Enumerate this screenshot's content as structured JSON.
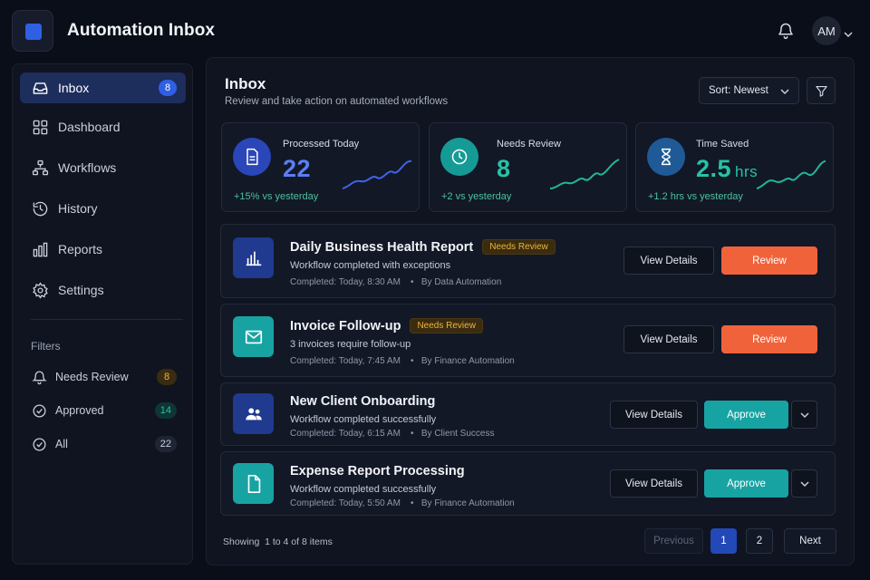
{
  "app": {
    "title": "Automation Inbox",
    "user_initials": "AM"
  },
  "sidebar": {
    "nav": [
      {
        "label": "Inbox",
        "badge": "8",
        "icon": "inbox-icon",
        "active": true
      },
      {
        "label": "Dashboard",
        "icon": "dashboard-icon"
      },
      {
        "label": "Workflows",
        "icon": "workflow-icon"
      },
      {
        "label": "History",
        "icon": "history-icon"
      },
      {
        "label": "Reports",
        "icon": "reports-icon"
      },
      {
        "label": "Settings",
        "icon": "gear-icon"
      }
    ],
    "filters_title": "Filters",
    "filters": [
      {
        "label": "Needs Review",
        "count": "8",
        "icon": "bell-icon",
        "color": "#f0b43c"
      },
      {
        "label": "Approved",
        "count": "14",
        "icon": "check-circle-icon",
        "color": "#27c2a5"
      },
      {
        "label": "All",
        "count": "22",
        "icon": "check-circle-icon",
        "color": "#c9cfdb"
      }
    ]
  },
  "main": {
    "title": "Inbox",
    "subtitle": "Review and take action on automated workflows",
    "sort_label": "Sort: Newest"
  },
  "stats": [
    {
      "label": "Processed Today",
      "value": "22",
      "unit": "",
      "delta": "+15% vs yesterday",
      "color": "#4c6ff0",
      "icon": "document-icon"
    },
    {
      "label": "Needs Review",
      "value": "8",
      "unit": "",
      "delta": "+2 vs yesterday",
      "color": "#27c2a5",
      "icon": "clock-icon"
    },
    {
      "label": "Time Saved",
      "value": "2.5",
      "unit": "hrs",
      "delta": "+1.2 hrs vs yesterday",
      "color": "#27c2a5",
      "icon": "hourglass-icon"
    }
  ],
  "workflows": [
    {
      "title": "Daily Business Health Report",
      "badge": "Needs Review",
      "desc": "Workflow completed with exceptions",
      "completed": "Completed: Today, 8:30 AM",
      "by": "By Data Automation",
      "details_label": "View Details",
      "action_label": "Review",
      "icon": "bar-chart-icon"
    },
    {
      "title": "Invoice Follow-up",
      "badge": "Needs Review",
      "desc": "3 invoices require follow-up",
      "completed": "Completed: Today, 7:45 AM",
      "by": "By Finance Automation",
      "details_label": "View Details",
      "action_label": "Review",
      "icon": "mail-icon"
    },
    {
      "title": "New Client Onboarding",
      "badge": "",
      "desc": "Workflow completed successfully",
      "completed": "Completed: Today, 6:15 AM",
      "by": "By Client Success",
      "details_label": "View Details",
      "action_label": "Approve",
      "icon": "users-icon"
    },
    {
      "title": "Expense Report Processing",
      "badge": "",
      "desc": "Workflow completed successfully",
      "completed": "Completed: Today, 5:50 AM",
      "by": "By Finance Automation",
      "details_label": "View Details",
      "action_label": "Approve",
      "icon": "file-icon"
    }
  ],
  "pagination": {
    "showing": "Showing  1 to 4 of 8 items",
    "prev_label": "Previous",
    "pages": [
      "1",
      "2"
    ],
    "next_label": "Next"
  }
}
